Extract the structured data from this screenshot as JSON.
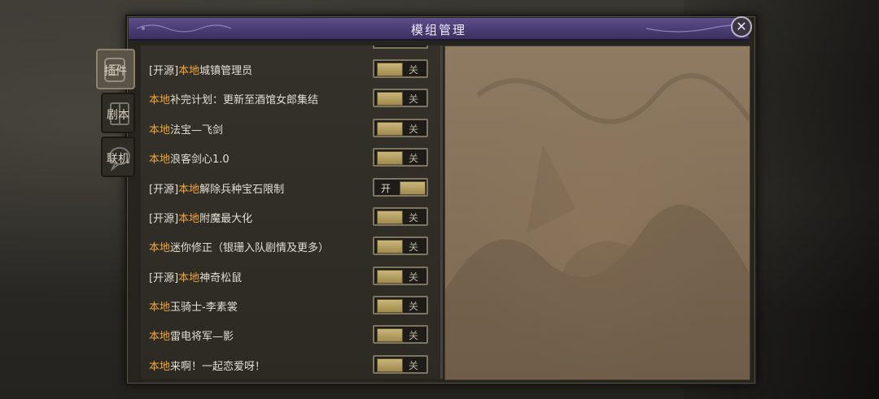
{
  "dialog": {
    "title": "模组管理",
    "close_symbol": "✕"
  },
  "tabs": [
    {
      "label": "插件",
      "active": true
    },
    {
      "label": "剧本",
      "active": false
    },
    {
      "label": "联机",
      "active": false
    }
  ],
  "mods": [
    {
      "prefix": "[开源]",
      "local": "本地",
      "name": "城镇管理员",
      "state": "关"
    },
    {
      "prefix": "",
      "local": "本地",
      "name": "补完计划：更新至酒馆女郎集结",
      "state": "关"
    },
    {
      "prefix": "",
      "local": "本地",
      "name": "法宝—飞剑",
      "state": "关"
    },
    {
      "prefix": "",
      "local": "本地",
      "name": "浪客剑心1.0",
      "state": "关"
    },
    {
      "prefix": "[开源]",
      "local": "本地",
      "name": "解除兵种宝石限制",
      "state": "开"
    },
    {
      "prefix": "[开源]",
      "local": "本地",
      "name": "附魔最大化",
      "state": "关"
    },
    {
      "prefix": "",
      "local": "本地",
      "name": "迷你修正（银珊入队剧情及更多）",
      "state": "关"
    },
    {
      "prefix": "[开源]",
      "local": "本地",
      "name": "神奇松鼠",
      "state": "关"
    },
    {
      "prefix": "",
      "local": "本地",
      "name": "玉骑士-李素裳",
      "state": "关"
    },
    {
      "prefix": "",
      "local": "本地",
      "name": "雷电将军—影",
      "state": "关"
    },
    {
      "prefix": "",
      "local": "本地",
      "name": "来啊！一起恋爱呀！",
      "state": "关"
    }
  ],
  "colors": {
    "local_tag": "#f0a53a",
    "title_bar": "#4a3c73"
  }
}
